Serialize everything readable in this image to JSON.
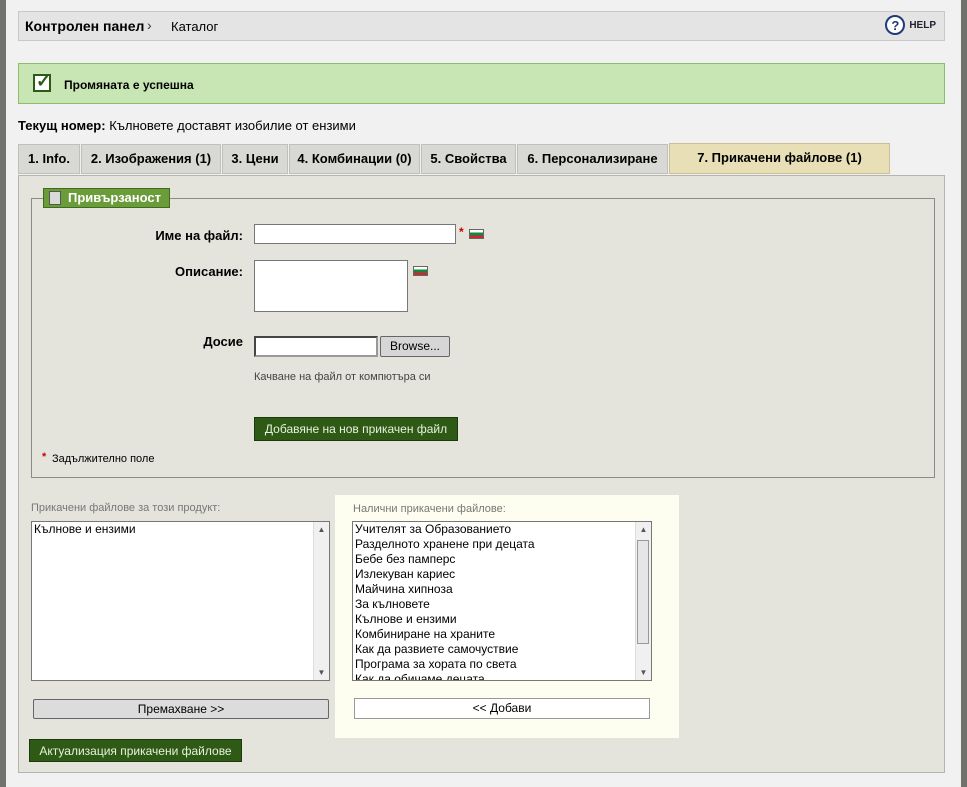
{
  "header": {
    "breadcrumb_main": "Контролен панел",
    "separator": "›",
    "breadcrumb_sub": "Каталог",
    "help_label": "HELP"
  },
  "success": {
    "message": "Промяната е успешна"
  },
  "current": {
    "label": "Текущ номер:",
    "value": "Кълновете доставят изобилие от ензими"
  },
  "tabs": [
    {
      "label": "1. Info."
    },
    {
      "label": "2. Изображения (1)"
    },
    {
      "label": "3. Цени"
    },
    {
      "label": "4. Комбинации (0)"
    },
    {
      "label": "5. Свойства"
    },
    {
      "label": "6. Персонализиране"
    },
    {
      "label": "7. Прикачени файлове (1)"
    }
  ],
  "form": {
    "legend": "Привързаност",
    "filename_label": "Име на файл:",
    "required_star": "*",
    "description_label": "Описание:",
    "file_label": "Досие",
    "browse_label": "Browse...",
    "upload_hint": "Качване на файл от компютъра си",
    "add_button": "Добавяне на нов прикачен файл",
    "required_note": "Задължително поле"
  },
  "attached": {
    "label": "Прикачени файлове за този продукт:",
    "items": [
      "Кълнове и ензими"
    ],
    "remove_button": "Премахване >>"
  },
  "available": {
    "label": "Налични прикачени файлове:",
    "items": [
      "Учителят за Образованието",
      "Разделното хранене при децата",
      "Бебе без памперс",
      "Излекуван кариес",
      "Майчина хипноза",
      "За кълновете",
      "Кълнове и ензими",
      "Комбиниране на храните",
      "Как да развиете самочуствие",
      "Програма за хората по света",
      "Как да обичаме децата"
    ],
    "add_button": "<< Добави"
  },
  "update_button": "Актуализация прикачени файлове",
  "colors": {
    "accent_green": "#2e5a16",
    "legend_green": "#6a9c3a",
    "success_bg": "#c8e6b4",
    "active_tab": "#e8dfb7"
  }
}
